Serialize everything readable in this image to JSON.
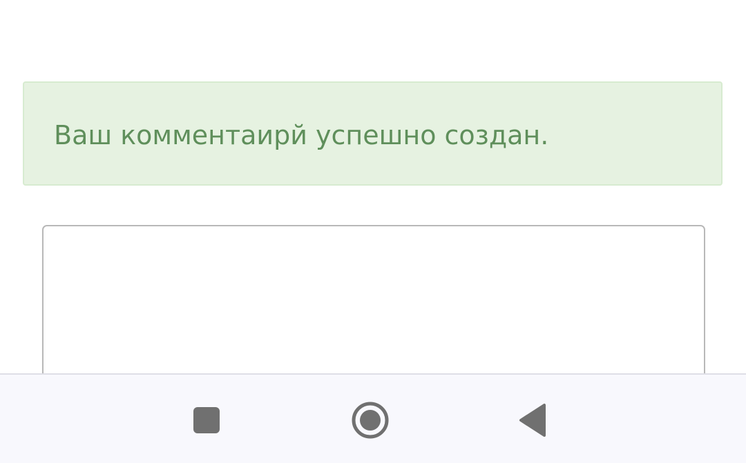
{
  "alert": {
    "message": "Ваш комментаирй успешно создан."
  },
  "comment_box": {
    "value": ""
  },
  "navigation_bar": {
    "recents_icon": "square-recents-icon",
    "home_icon": "circle-home-icon",
    "back_icon": "triangle-back-icon"
  },
  "colors": {
    "success_background": "#e6f2e1",
    "success_text": "#5f8f5b",
    "navigation_background": "#f8f8fd",
    "navigation_icons": "#707070"
  }
}
